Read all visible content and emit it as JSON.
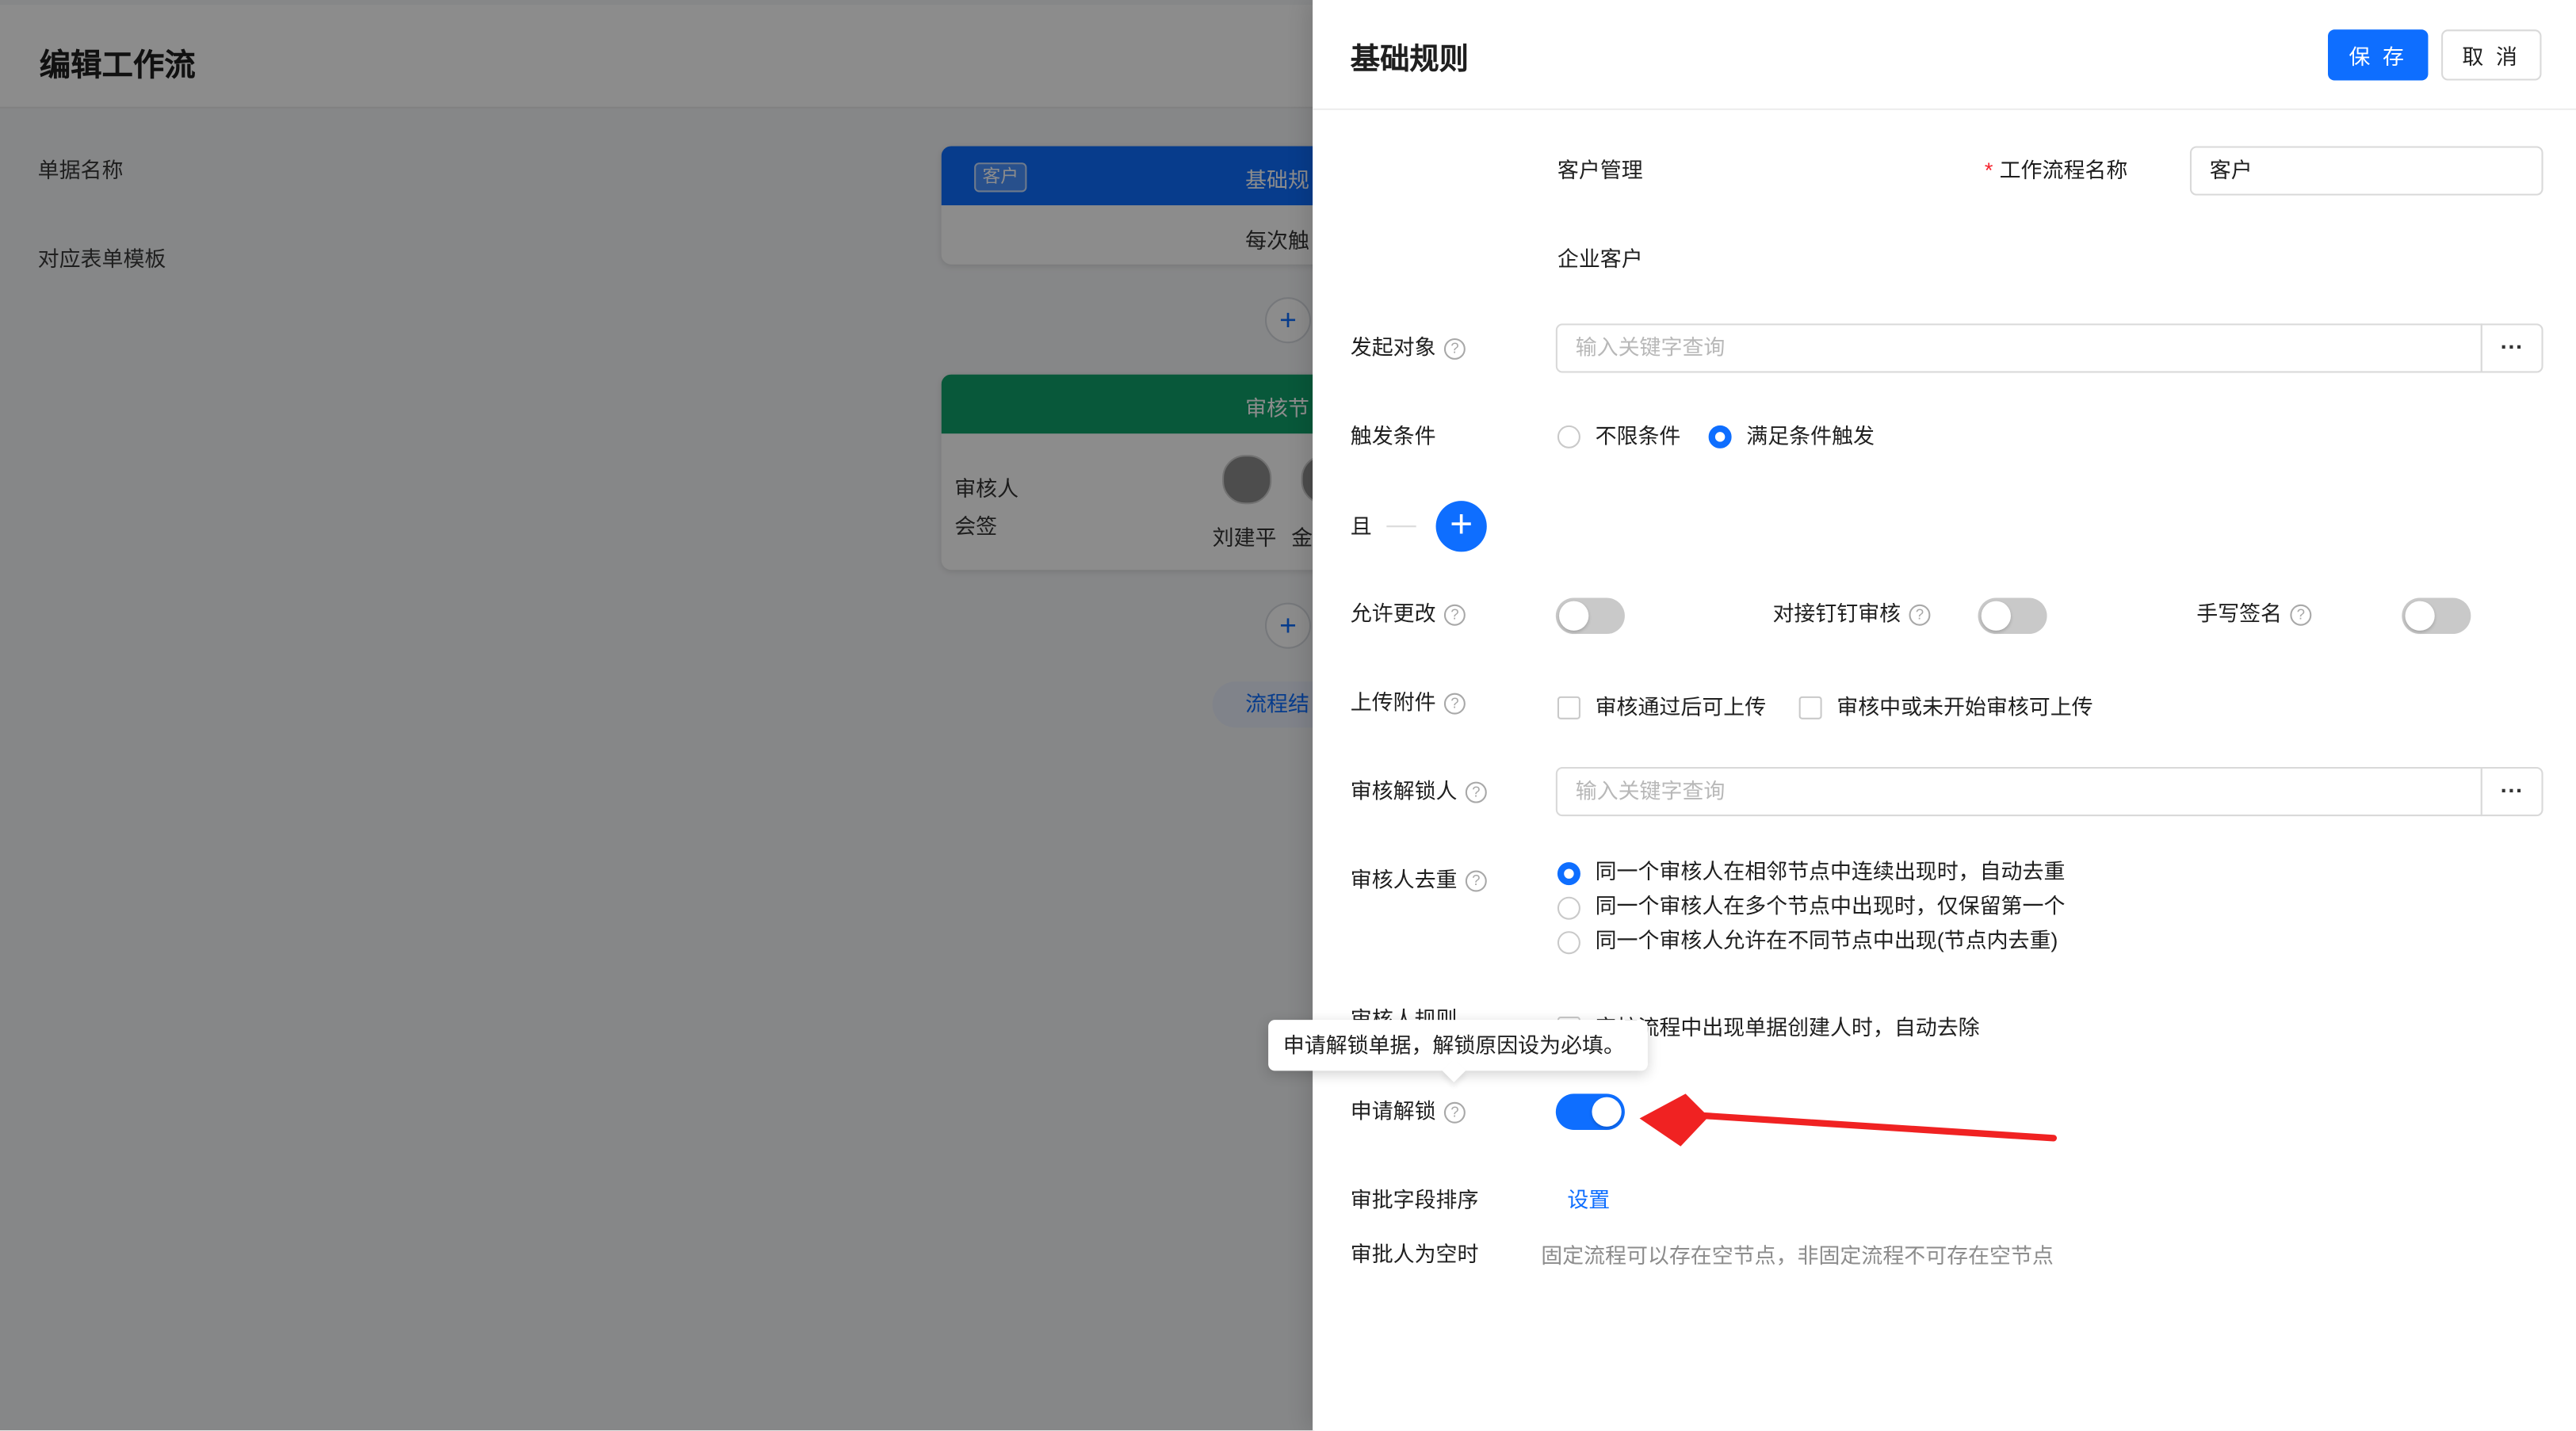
{
  "background": {
    "page_title": "编辑工作流",
    "node1": {
      "tag": "客户",
      "title": "基础规",
      "subtitle": "每次触"
    },
    "node2": {
      "title": "审核节",
      "role_label": "审核人",
      "mode_label": "会签",
      "reviewer1": "刘建平",
      "reviewer2": "金"
    },
    "add_glyph": "+",
    "end_label": "流程结"
  },
  "drawer": {
    "title": "基础规则",
    "save_label": "保 存",
    "cancel_label": "取 消",
    "fields": {
      "doc_name_label": "单据名称",
      "doc_name_value": "客户管理",
      "workflow_name_label": "工作流程名称",
      "workflow_name_value": "客户",
      "form_template_label": "对应表单模板",
      "form_template_value": "企业客户",
      "initiator_label": "发起对象",
      "initiator_placeholder": "输入关键字查询",
      "trigger_label": "触发条件",
      "trigger_options": [
        "不限条件",
        "满足条件触发"
      ],
      "and_label": "且",
      "allow_change_label": "允许更改",
      "dingtalk_label": "对接钉钉审核",
      "handwrite_label": "手写签名",
      "upload_label": "上传附件",
      "upload_options": [
        "审核通过后可上传",
        "审核中或未开始审核可上传"
      ],
      "unlocker_label": "审核解锁人",
      "unlocker_placeholder": "输入关键字查询",
      "dedupe_label": "审核人去重",
      "dedupe_options": [
        "同一个审核人在相邻节点中连续出现时，自动去重",
        "同一个审核人在多个节点中出现时，仅保留第一个",
        "同一个审核人允许在不同节点中出现(节点内去重)"
      ],
      "reviewer_rule_label": "审核人规则",
      "reviewer_rule_option": "审核流程中出现单据创建人时，自动去除",
      "apply_unlock_label": "申请解锁",
      "field_order_label": "审批字段排序",
      "field_order_link": "设置",
      "empty_approver_label": "审批人为空时",
      "empty_approver_text": "固定流程可以存在空节点，非固定流程不可存在空节点"
    },
    "tooltip": "申请解锁单据，解锁原因设为必填。",
    "ellipsis": "···",
    "help_glyph": "?",
    "required_mark": "*",
    "toggles": {
      "allow_change": false,
      "dingtalk": false,
      "handwrite": false,
      "apply_unlock": true
    },
    "trigger_selected": 1,
    "dedupe_selected": 0
  },
  "colors": {
    "primary": "#0e6eff",
    "audit_node": "#10a06a",
    "annotation_arrow": "#f02222"
  }
}
